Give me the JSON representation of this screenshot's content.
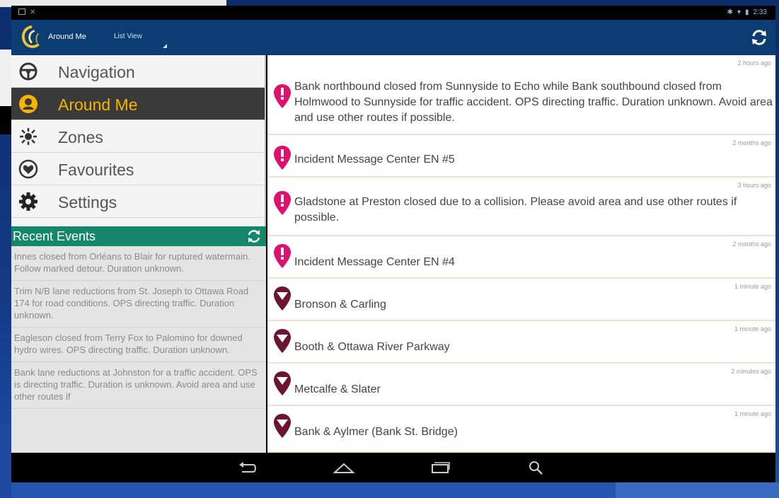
{
  "colors": {
    "action_bar": "#0b3d72",
    "active_item_bg": "#3a3a3a",
    "active_item_text": "#f6b400",
    "recent_header": "#14876a",
    "pin_incident": "#e0116d",
    "pin_construction": "#6b1530"
  },
  "status_bar": {
    "time": "2:33"
  },
  "action_bar": {
    "title": "Around Me",
    "view_selector": "List View",
    "refresh_icon": "refresh-icon"
  },
  "drawer": {
    "items": [
      {
        "label": "Navigation",
        "icon": "steering-wheel-icon",
        "active": false
      },
      {
        "label": "Around Me",
        "icon": "person-icon",
        "active": true
      },
      {
        "label": "Zones",
        "icon": "zones-icon",
        "active": false
      },
      {
        "label": "Favourites",
        "icon": "heart-icon",
        "active": false
      },
      {
        "label": "Settings",
        "icon": "gear-icon",
        "active": false
      }
    ],
    "recent_events_title": "Recent Events",
    "recent_events": [
      "Innes closed from Orléans to Blair for ruptured watermain. Follow marked detour. Duration unknown.",
      "Trim N/B lane reductions from St. Joseph to Ottawa Road 174 for road conditions. OPS directing traffic. Duration unknown.",
      "Eagleson closed from Terry Fox to Palomino for downed hydro wires. OPS directing traffic. Duration unknown.",
      "Bank lane reductions at Johnston for a traffic accident. OPS is directing traffic. Duration is unknown. Avoid area and use other routes if"
    ]
  },
  "events": [
    {
      "time": "2 hours ago",
      "text": "Bank northbound closed from Sunnyside to Echo while Bank southbound closed from Holmwood to Sunnyside for traffic accident.  OPS directing traffic.  Duration unknown.  Avoid area and use other routes if possible.",
      "pin": "incident-pin-icon"
    },
    {
      "time": "2 months ago",
      "text": "Incident Message Center EN #5",
      "pin": "incident-pin-icon"
    },
    {
      "time": "3 hours ago",
      "text": "Gladstone at Preston closed due to a collision.  Please avoid area and use other routes if possible.",
      "pin": "incident-pin-icon"
    },
    {
      "time": "2 months ago",
      "text": "Incident Message Center EN #4",
      "pin": "incident-pin-icon"
    },
    {
      "time": "1 minute ago",
      "text": "Bronson & Carling",
      "pin": "construction-pin-icon"
    },
    {
      "time": "1 minute ago",
      "text": "Booth & Ottawa River Parkway",
      "pin": "construction-pin-icon"
    },
    {
      "time": "2 minutes ago",
      "text": "Metcalfe & Slater",
      "pin": "construction-pin-icon"
    },
    {
      "time": "1 minute ago",
      "text": "Bank & Aylmer (Bank St. Bridge)",
      "pin": "construction-pin-icon"
    }
  ],
  "nav_bar": [
    "back-icon",
    "home-icon",
    "recent-apps-icon",
    "search-icon"
  ]
}
